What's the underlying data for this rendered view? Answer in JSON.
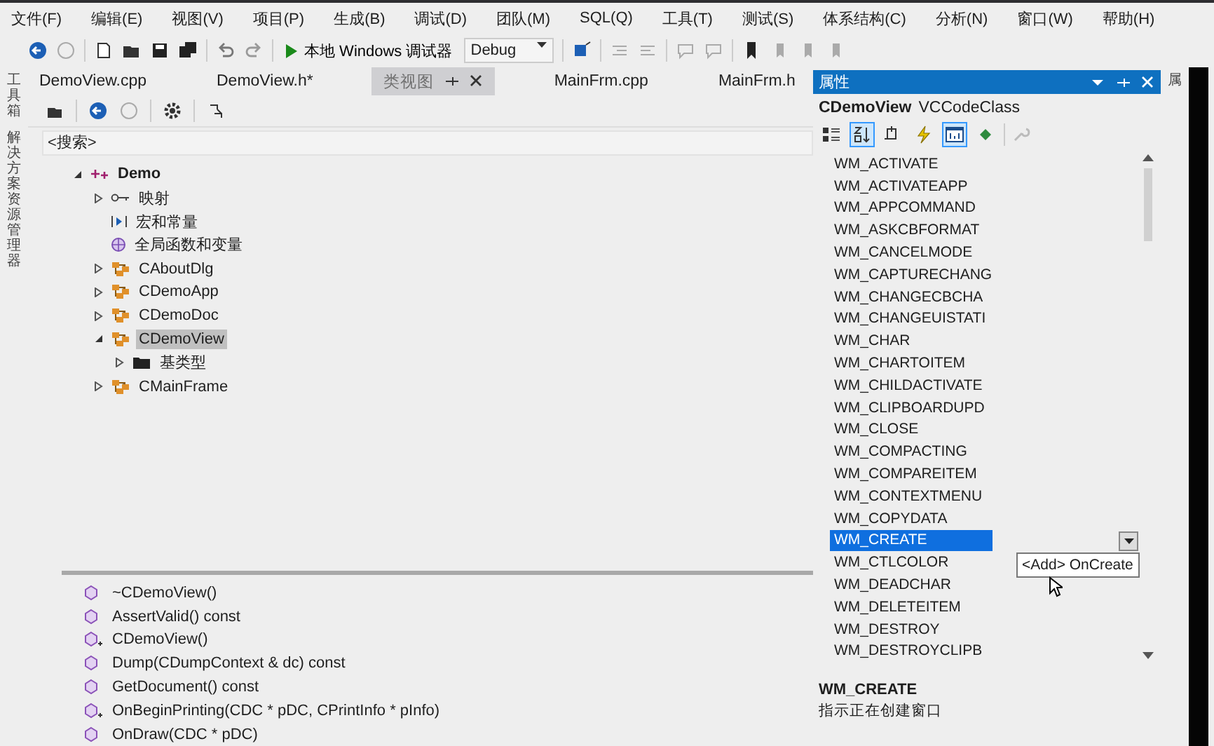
{
  "menu": [
    "文件(F)",
    "编辑(E)",
    "视图(V)",
    "项目(P)",
    "生成(B)",
    "调试(D)",
    "团队(M)",
    "SQL(Q)",
    "工具(T)",
    "测试(S)",
    "体系结构(C)",
    "分析(N)",
    "窗口(W)",
    "帮助(H)"
  ],
  "toolbar": {
    "run_label": "本地 Windows 调试器",
    "config": "Debug"
  },
  "left_strip": [
    "工具箱",
    "解决方案资源管理器"
  ],
  "right_strip": [
    "属"
  ],
  "tabs": [
    {
      "label": "DemoView.cpp",
      "selected": false
    },
    {
      "label": "DemoView.h*",
      "selected": false
    },
    {
      "label": "类视图",
      "selected": true
    },
    {
      "label": "MainFrm.cpp",
      "selected": false
    },
    {
      "label": "MainFrm.h",
      "selected": false
    }
  ],
  "class_view": {
    "search": {
      "placeholder": "<搜索>"
    },
    "tree": [
      {
        "label": "Demo",
        "kind": "project",
        "expanded": true,
        "selected": false,
        "children": [
          {
            "label": "映射",
            "kind": "map",
            "expanded": false,
            "selected": false
          },
          {
            "label": "宏和常量",
            "kind": "macro",
            "selected": false
          },
          {
            "label": "全局函数和变量",
            "kind": "globals",
            "selected": false
          },
          {
            "label": "CAboutDlg",
            "kind": "class",
            "expanded": false,
            "selected": false
          },
          {
            "label": "CDemoApp",
            "kind": "class",
            "expanded": false,
            "selected": false
          },
          {
            "label": "CDemoDoc",
            "kind": "class",
            "expanded": false,
            "selected": false
          },
          {
            "label": "CDemoView",
            "kind": "class",
            "expanded": true,
            "selected": true,
            "children": [
              {
                "label": "基类型",
                "kind": "folder",
                "expanded": false,
                "selected": false
              }
            ]
          },
          {
            "label": "CMainFrame",
            "kind": "class",
            "expanded": false,
            "selected": false
          }
        ]
      }
    ],
    "members": [
      {
        "label": "~CDemoView()",
        "kind": "public"
      },
      {
        "label": "AssertValid() const",
        "kind": "public"
      },
      {
        "label": "CDemoView()",
        "kind": "protected"
      },
      {
        "label": "Dump(CDumpContext & dc) const",
        "kind": "public"
      },
      {
        "label": "GetDocument() const",
        "kind": "public"
      },
      {
        "label": "OnBeginPrinting(CDC * pDC, CPrintInfo * pInfo)",
        "kind": "protected"
      },
      {
        "label": "OnDraw(CDC * pDC)",
        "kind": "public"
      }
    ]
  },
  "properties": {
    "title": "属性",
    "object_name": "CDemoView",
    "object_type": "VCCodeClass",
    "tools": [
      {
        "selected": false
      },
      {
        "selected": true
      },
      {
        "selected": false
      },
      {
        "selected": false
      },
      {
        "selected": true
      },
      {
        "selected": false
      }
    ],
    "messages": [
      {
        "label": "WM_ACTIVATE",
        "selected": false
      },
      {
        "label": "WM_ACTIVATEAPP",
        "selected": false
      },
      {
        "label": "WM_APPCOMMAND",
        "selected": false
      },
      {
        "label": "WM_ASKCBFORMAT",
        "selected": false
      },
      {
        "label": "WM_CANCELMODE",
        "selected": false
      },
      {
        "label": "WM_CAPTURECHANG",
        "selected": false
      },
      {
        "label": "WM_CHANGECBCHA",
        "selected": false
      },
      {
        "label": "WM_CHANGEUISTATI",
        "selected": false
      },
      {
        "label": "WM_CHAR",
        "selected": false
      },
      {
        "label": "WM_CHARTOITEM",
        "selected": false
      },
      {
        "label": "WM_CHILDACTIVATE",
        "selected": false
      },
      {
        "label": "WM_CLIPBOARDUPD",
        "selected": false
      },
      {
        "label": "WM_CLOSE",
        "selected": false
      },
      {
        "label": "WM_COMPACTING",
        "selected": false
      },
      {
        "label": "WM_COMPAREITEM",
        "selected": false
      },
      {
        "label": "WM_CONTEXTMENU",
        "selected": false
      },
      {
        "label": "WM_COPYDATA",
        "selected": false
      },
      {
        "label": "WM_CREATE",
        "selected": true
      },
      {
        "label": "WM_CTLCOLOR",
        "selected": false
      },
      {
        "label": "WM_DEADCHAR",
        "selected": false
      },
      {
        "label": "WM_DELETEITEM",
        "selected": false
      },
      {
        "label": "WM_DESTROY",
        "selected": false
      },
      {
        "label": "WM_DESTROYCLIPB",
        "selected": false
      }
    ],
    "handler_option": "<Add> OnCreate",
    "description": {
      "title": "WM_CREATE",
      "text": "指示正在创建窗口"
    }
  }
}
